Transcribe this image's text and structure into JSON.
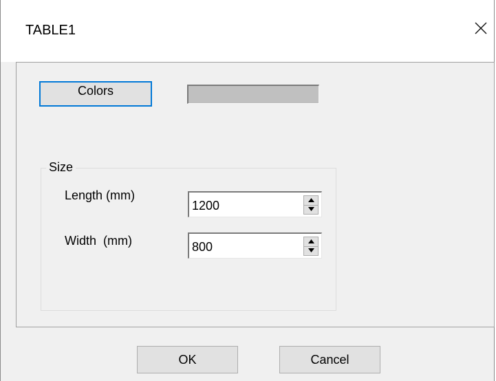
{
  "window": {
    "title": "TABLE1",
    "close_icon": "close-icon"
  },
  "colors": {
    "button_label": "Colors",
    "swatch_color": "#c0c0c0"
  },
  "size_group": {
    "label": "Size",
    "length_label": "Length (mm)",
    "length_value": "1200",
    "width_label": "Width  (mm)",
    "width_value": "800"
  },
  "footer": {
    "ok_label": "OK",
    "cancel_label": "Cancel"
  }
}
